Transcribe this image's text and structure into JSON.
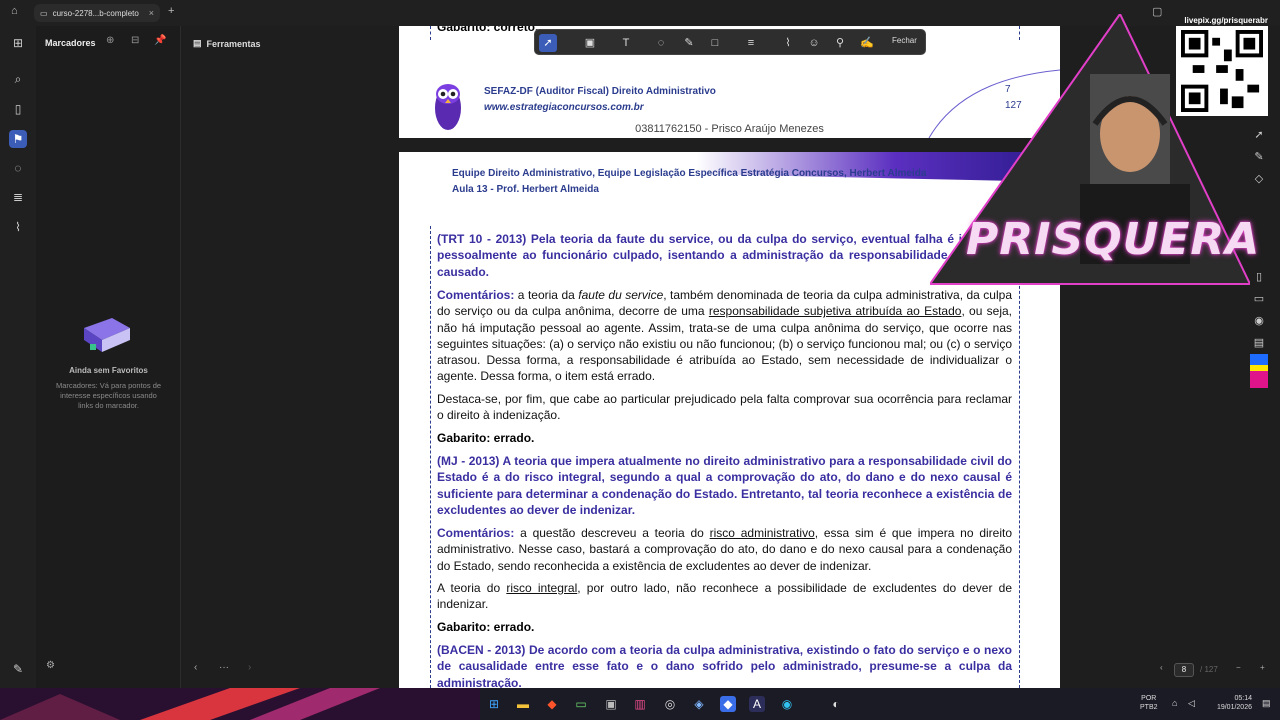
{
  "browser": {
    "tab_title": "curso-2278...b-completo",
    "tab_close": "×",
    "new_tab": "+"
  },
  "sidebar": {
    "panel_title": "Marcadores",
    "empty_title": "Ainda sem Favoritos",
    "empty_desc": "Marcadores: Vá para pontos de interesse específicos usando links do marcador.",
    "tools_label": "Ferramentas"
  },
  "toolbar": {
    "close_label": "Fechar"
  },
  "page_header": {
    "prev_text": "Gabarito: correto.",
    "course_title": "SEFAZ-DF (Auditor Fiscal) Direito Administrativo",
    "course_site": "www.estrategiaconcursos.com.br",
    "page_num": "7",
    "page_total": "127",
    "watermark": "03811762150 - Prisco Araújo Menezes",
    "team": "Equipe Direito Administrativo, Equipe Legislação Específica Estratégia Concursos, Herbert Almeida",
    "lesson": "Aula 13 - Prof. Herbert Almeida"
  },
  "content": {
    "q1": "(TRT 10 - 2013) Pela teoria da faute du service, ou da culpa do serviço, eventual falha é imputada pessoalmente ao funcionário culpado, isentando a administração da responsabilidade pelo dano causado.",
    "c1_label": "Comentários:",
    "c1_a": " a teoria da ",
    "c1_italic": "faute du service",
    "c1_b": ", também denominada de teoria da culpa administrativa, da culpa do serviço ou da culpa anônima, decorre de uma ",
    "c1_underline": "responsabilidade subjetiva atribuída ao Estado",
    "c1_c": ", ou seja, não há imputação pessoal ao agente. Assim, trata-se de uma culpa anônima do serviço, que ocorre nas seguintes situações: (a) o serviço não existiu ou não funcionou; (b) o serviço funcionou mal; ou (c) o serviço atrasou. Dessa forma, a responsabilidade é atribuída ao Estado, sem necessidade de individualizar o agente. Dessa forma, o item está errado.",
    "p1b": "Destaca-se, por fim, que cabe ao particular prejudicado pela falta comprovar sua ocorrência para reclamar o direito à indenização.",
    "a1": "Gabarito: errado.",
    "q2": "(MJ - 2013) A teoria que impera atualmente no direito administrativo para a responsabilidade civil do Estado é a do risco integral, segundo a qual a comprovação do ato, do dano e do nexo causal é suficiente para determinar a condenação do Estado. Entretanto, tal teoria reconhece a existência de excludentes ao dever de indenizar.",
    "c2_label": "Comentários:",
    "c2_a": " a questão descreveu a teoria do ",
    "c2_underline": "risco administrativo",
    "c2_b": ", essa sim é que impera no direito administrativo. Nesse caso, bastará a comprovação do ato, do dano e do nexo causal para a condenação do Estado, sendo reconhecida a existência de excludentes ao dever de indenizar.",
    "p2_a": "A teoria do ",
    "p2_underline": "risco integral",
    "p2_b": ", por outro lado, não reconhece a possibilidade de excludentes do dever de indenizar.",
    "a2": "Gabarito: errado.",
    "q3": "(BACEN - 2013) De acordo com a teoria da culpa administrativa, existindo o fato do serviço e o nexo de causalidade entre esse fato e o dano sofrido pelo administrado, presume-se a culpa da administração."
  },
  "overlay": {
    "qr_url": "livepix.gg/prisquerabr",
    "brand": "PRISQUERA"
  },
  "pager": {
    "current": "8",
    "total": "/ 127",
    "left_dots": "···"
  },
  "tray": {
    "lang1": "POR",
    "lang2": "PTB2",
    "time": "05:14",
    "date": "19/01/2026"
  },
  "colors": {
    "accent": "#3b5db8",
    "heading_blue": "#2b3c8e",
    "question_purple": "#3a2fa0",
    "brand_pink": "#e23fc9"
  }
}
